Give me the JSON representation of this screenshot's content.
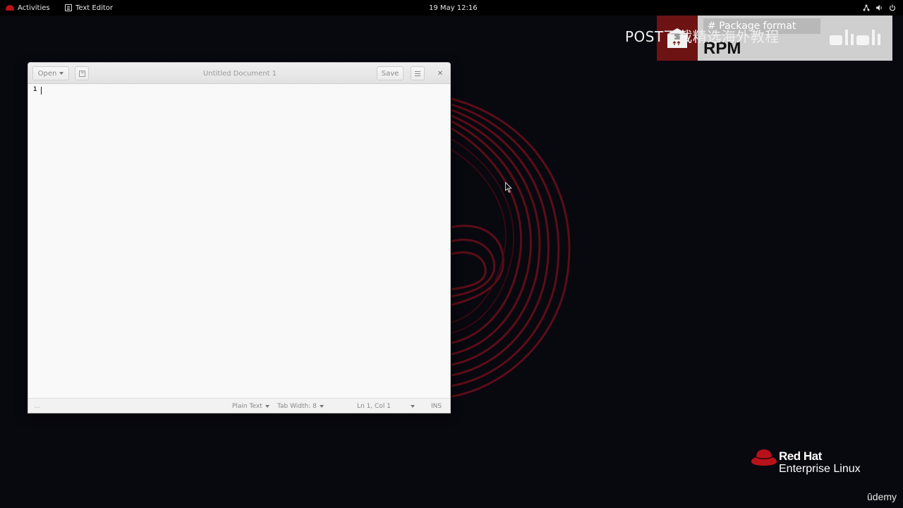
{
  "topbar": {
    "activities": "Activities",
    "app_name": "Text Editor",
    "clock": "19 May  12:16",
    "tray_icons": [
      "network-icon",
      "volume-icon",
      "power-icon"
    ]
  },
  "editor": {
    "open_label": "Open",
    "document_title": "Untitled Document 1",
    "save_label": "Save",
    "line_number": "1",
    "status": {
      "dots": "...",
      "language": "Plain Text",
      "tab_width": "Tab Width: 8",
      "position": "Ln 1, Col 1",
      "mode": "INS"
    }
  },
  "overlay": {
    "title": "POST下载精选海外教程",
    "heading": "# Package format",
    "rpm": "RPM"
  },
  "brand": {
    "line1": "Red Hat",
    "line2": "Enterprise Linux",
    "watermark": "ûdemy"
  },
  "colors": {
    "desktop_bg": "#08080f",
    "swirl": "#6b0f1a",
    "brand_red": "#b7121a",
    "window_bg": "#f7f7f7"
  }
}
